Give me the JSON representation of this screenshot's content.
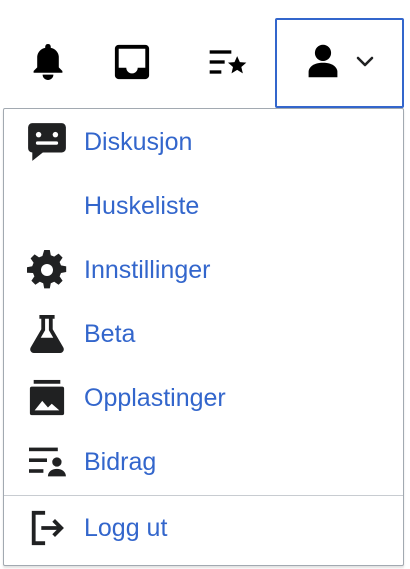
{
  "topbar": {
    "icons": [
      "bell-icon",
      "inbox-icon",
      "watchlist-icon"
    ],
    "user_menu": {
      "icon": "user-avatar-icon",
      "chevron": "chevron-down-icon",
      "expanded": true
    }
  },
  "menu": {
    "items": [
      {
        "label": "Diskusjon",
        "icon": "talk-icon"
      },
      {
        "label": "Huskeliste",
        "icon": ""
      },
      {
        "label": "Innstillinger",
        "icon": "settings-icon"
      },
      {
        "label": "Beta",
        "icon": "flask-icon"
      },
      {
        "label": "Opplastinger",
        "icon": "image-gallery-icon"
      },
      {
        "label": "Bidrag",
        "icon": "user-contributions-icon"
      }
    ],
    "logout": {
      "label": "Logg ut",
      "icon": "logout-icon"
    }
  },
  "colors": {
    "link": "#3366cc",
    "icon": "#202122",
    "border": "#a2a9b1",
    "focus_border": "#3366cc"
  }
}
